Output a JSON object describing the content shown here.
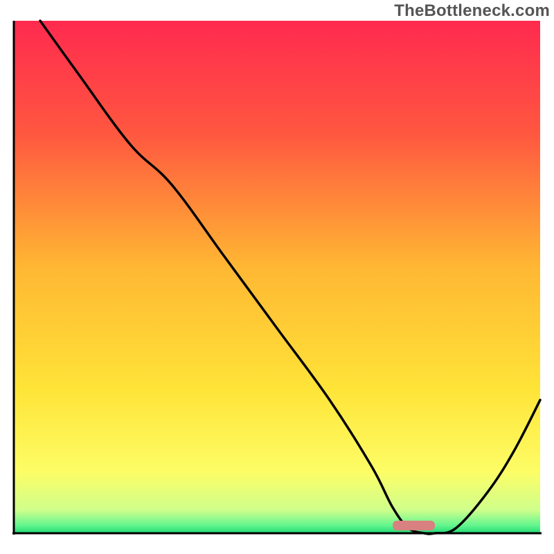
{
  "attribution": "TheBottleneck.com",
  "chart_data": {
    "type": "line",
    "title": "",
    "xlabel": "",
    "ylabel": "",
    "xlim": [
      0,
      100
    ],
    "ylim": [
      0,
      100
    ],
    "grid": false,
    "legend": false,
    "background_gradient": {
      "stops": [
        {
          "pos": 0.0,
          "color": "#ff2a4f"
        },
        {
          "pos": 0.22,
          "color": "#ff5740"
        },
        {
          "pos": 0.48,
          "color": "#ffb733"
        },
        {
          "pos": 0.72,
          "color": "#ffe438"
        },
        {
          "pos": 0.88,
          "color": "#fdfd66"
        },
        {
          "pos": 0.955,
          "color": "#cfff8c"
        },
        {
          "pos": 0.985,
          "color": "#62f58e"
        },
        {
          "pos": 1.0,
          "color": "#20d973"
        }
      ]
    },
    "series": [
      {
        "name": "bottleneck-curve",
        "x": [
          5,
          12,
          22,
          30,
          40,
          50,
          60,
          68,
          72,
          75,
          78,
          80,
          84,
          90,
          95,
          100
        ],
        "y": [
          100,
          90,
          76,
          68,
          54,
          40,
          26,
          13,
          5,
          1,
          0,
          0,
          1,
          8,
          16,
          26
        ]
      }
    ],
    "optimal_marker": {
      "x_center": 76,
      "width": 8,
      "y": 1.5,
      "color": "#d98080"
    }
  }
}
